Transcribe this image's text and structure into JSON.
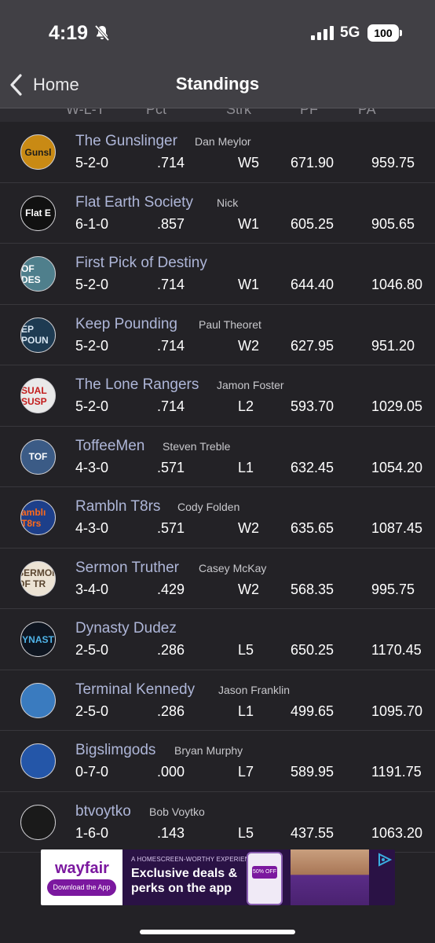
{
  "status": {
    "time": "4:19",
    "network": "5G",
    "battery": "100"
  },
  "nav": {
    "back_label": "Home",
    "title": "Standings"
  },
  "header_partial": [
    "W-L-T",
    "Pct",
    "Strk",
    "PF",
    "PA"
  ],
  "teams": [
    {
      "name": "The Gunslinger",
      "owner": "Dan Meylor",
      "record": "5-2-0",
      "pct": ".714",
      "streak": "W5",
      "pf": "671.90",
      "pa": "959.75",
      "logo_text": "Gunsl",
      "logo_bg": "#c98a14",
      "logo_fg": "#1b1b1b"
    },
    {
      "name": "Flat Earth Society",
      "owner": "Nick",
      "record": "6-1-0",
      "pct": ".857",
      "streak": "W1",
      "pf": "605.25",
      "pa": "905.65",
      "logo_text": "Flat E",
      "logo_bg": "#111111",
      "logo_fg": "#ffffff"
    },
    {
      "name": "First Pick of Destiny",
      "owner": "",
      "record": "5-2-0",
      "pct": ".714",
      "streak": "W1",
      "pf": "644.40",
      "pa": "1046.80",
      "logo_text": "OF DES",
      "logo_bg": "#4f7f8c",
      "logo_fg": "#ffffff"
    },
    {
      "name": "Keep Pounding",
      "owner": "Paul Theoret",
      "record": "5-2-0",
      "pct": ".714",
      "streak": "W2",
      "pf": "627.95",
      "pa": "951.20",
      "logo_text": "EP POUN",
      "logo_bg": "#1e3b52",
      "logo_fg": "#d8e6f2"
    },
    {
      "name": "The Lone Rangers",
      "owner": "Jamon Foster",
      "record": "5-2-0",
      "pct": ".714",
      "streak": "L2",
      "pf": "593.70",
      "pa": "1029.05",
      "logo_text": "SUAL SUSP",
      "logo_bg": "#e9e9e9",
      "logo_fg": "#c21b1b"
    },
    {
      "name": "ToffeeMen",
      "owner": "Steven Treble",
      "record": "4-3-0",
      "pct": ".571",
      "streak": "L1",
      "pf": "632.45",
      "pa": "1054.20",
      "logo_text": "TOF",
      "logo_bg": "#3b5b86",
      "logo_fg": "#ffffff"
    },
    {
      "name": "Rambln T8rs",
      "owner": "Cody Folden",
      "record": "4-3-0",
      "pct": ".571",
      "streak": "W2",
      "pf": "635.65",
      "pa": "1087.45",
      "logo_text": "amblı T8rs",
      "logo_bg": "#1d3f8a",
      "logo_fg": "#ff6a1a"
    },
    {
      "name": "Sermon Truther",
      "owner": "Casey McKay",
      "record": "3-4-0",
      "pct": ".429",
      "streak": "W2",
      "pf": "568.35",
      "pa": "995.75",
      "logo_text": "SERMON OF TR",
      "logo_bg": "#ece3d4",
      "logo_fg": "#5a4630"
    },
    {
      "name": "Dynasty Dudez",
      "owner": "",
      "record": "2-5-0",
      "pct": ".286",
      "streak": "L5",
      "pf": "650.25",
      "pa": "1170.45",
      "logo_text": "YNAST",
      "logo_bg": "#0e1520",
      "logo_fg": "#4fb3e8"
    },
    {
      "name": "Terminal Kennedy",
      "owner": "Jason Franklin",
      "record": "2-5-0",
      "pct": ".286",
      "streak": "L1",
      "pf": "499.65",
      "pa": "1095.70",
      "logo_text": "",
      "logo_bg": "#3a7bbf",
      "logo_fg": "#ffffff"
    },
    {
      "name": "Bigslimgods",
      "owner": "Bryan Murphy",
      "record": "0-7-0",
      "pct": ".000",
      "streak": "L7",
      "pf": "589.95",
      "pa": "1191.75",
      "logo_text": "",
      "logo_bg": "#2456a8",
      "logo_fg": "#ffffff"
    },
    {
      "name": "btvoytko",
      "owner": "Bob Voytko",
      "record": "1-6-0",
      "pct": ".143",
      "streak": "L5",
      "pf": "437.55",
      "pa": "1063.20",
      "logo_text": "",
      "logo_bg": "#1a1a1a",
      "logo_fg": "#e1b82c"
    }
  ],
  "ad": {
    "brand": "wayfair",
    "cta": "Download the App",
    "tagline": "A HOMESCREEN-WORTHY EXPERIENCE",
    "headline_1": "Exclusive deals &",
    "headline_2": "perks on the app",
    "phone_badge": "50% OFF",
    "accent": "#7b189f"
  }
}
